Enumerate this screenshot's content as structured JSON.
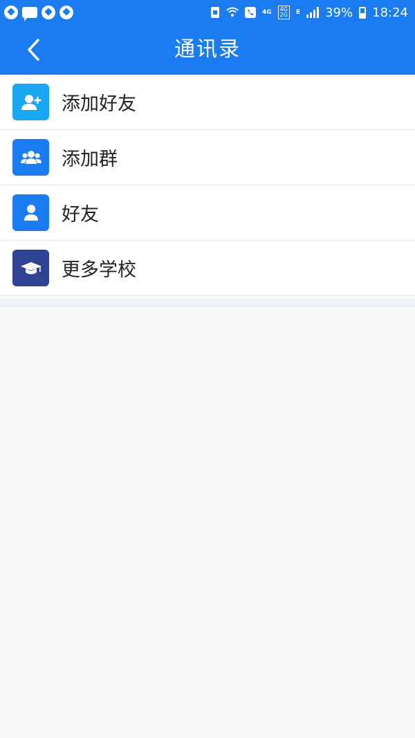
{
  "status_bar": {
    "battery": "39%",
    "time": "18:24",
    "net_4g": "4G",
    "net_box_top": "4G",
    "net_box_bottom": "2G",
    "net_e": "E"
  },
  "header": {
    "title": "通讯录"
  },
  "list": {
    "items": [
      {
        "label": "添加好友",
        "icon": "add-friend-icon",
        "color": "#1aa7f2"
      },
      {
        "label": "添加群",
        "icon": "group-icon",
        "color": "#1a7cf0"
      },
      {
        "label": "好友",
        "icon": "person-icon",
        "color": "#1a7cf0"
      },
      {
        "label": "更多学校",
        "icon": "graduation-cap-icon",
        "color": "#2f4294"
      }
    ]
  },
  "colors": {
    "primary": "#1a7cf0",
    "background": "#f6f8fa"
  }
}
